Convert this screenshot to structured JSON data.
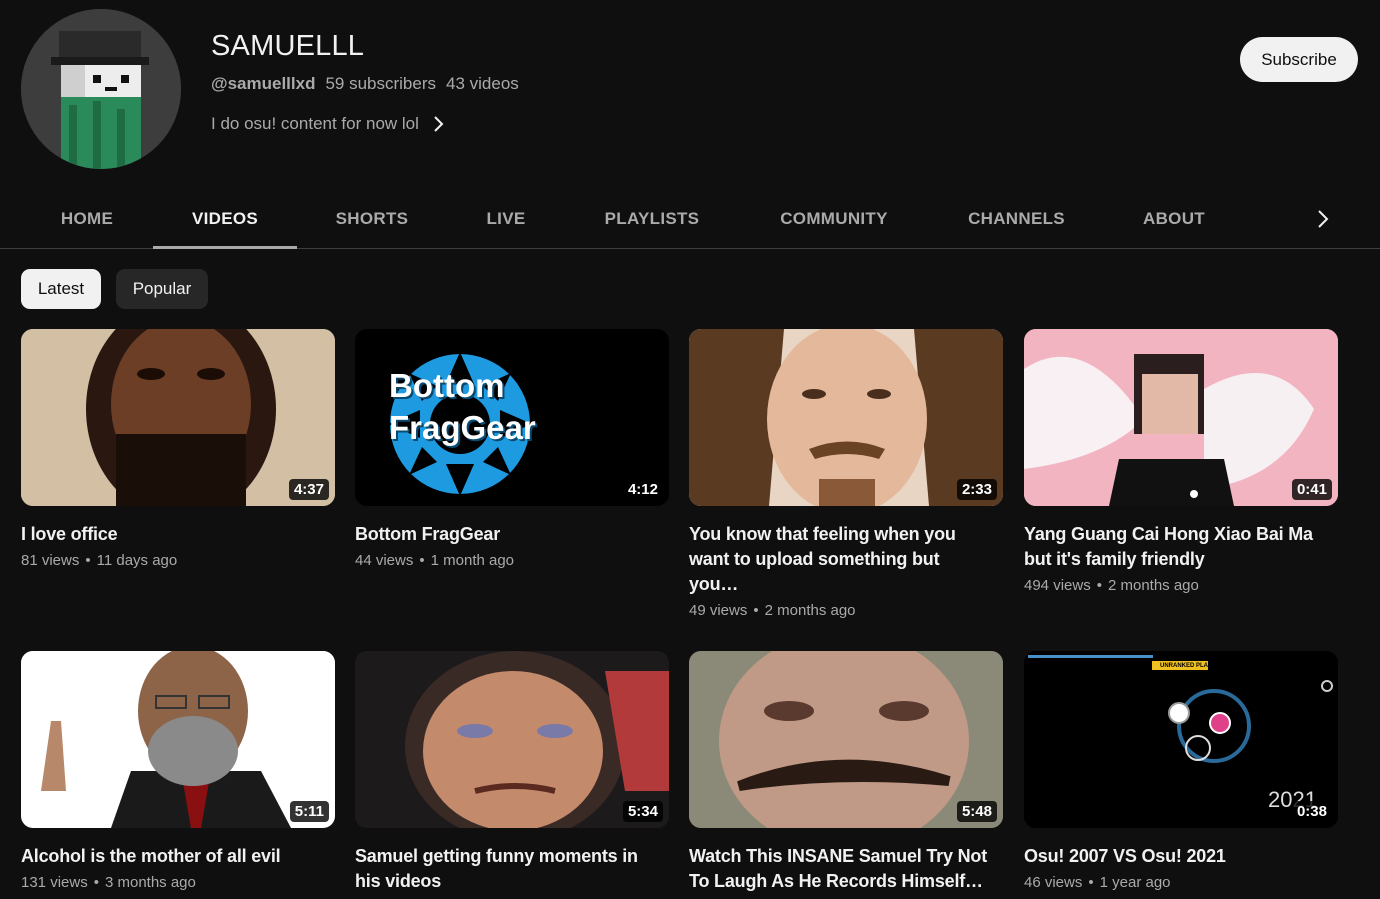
{
  "channel": {
    "name": "SAMUELLL",
    "handle": "@samuelllxd",
    "subscribers": "59 subscribers",
    "videos_count": "43 videos",
    "description": "I do osu! content for now lol",
    "subscribe_label": "Subscribe"
  },
  "tabs": [
    {
      "label": "HOME"
    },
    {
      "label": "VIDEOS"
    },
    {
      "label": "SHORTS"
    },
    {
      "label": "LIVE"
    },
    {
      "label": "PLAYLISTS"
    },
    {
      "label": "COMMUNITY"
    },
    {
      "label": "CHANNELS"
    },
    {
      "label": "ABOUT"
    }
  ],
  "active_tab": "VIDEOS",
  "chips": {
    "latest": "Latest",
    "popular": "Popular"
  },
  "videos": [
    {
      "title": "I love office",
      "views": "81 views",
      "age": "11 days ago",
      "duration": "4:37"
    },
    {
      "title": "Bottom FragGear",
      "views": "44 views",
      "age": "1 month ago",
      "duration": "4:12",
      "thumb_text_1": "Bottom",
      "thumb_text_2": "FragGear"
    },
    {
      "title": "You know that feeling when you want to upload something but you…",
      "views": "49 views",
      "age": "2 months ago",
      "duration": "2:33"
    },
    {
      "title": "Yang Guang Cai Hong Xiao Bai Ma but it's family friendly",
      "views": "494 views",
      "age": "2 months ago",
      "duration": "0:41"
    },
    {
      "title": "Alcohol is the mother of all evil",
      "views": "131 views",
      "age": "3 months ago",
      "duration": "5:11"
    },
    {
      "title": "Samuel getting funny moments in his videos",
      "views": "",
      "age": "",
      "duration": "5:34"
    },
    {
      "title": "Watch This INSANE Samuel Try Not To Laugh As He Records Himself…",
      "views": "",
      "age": "",
      "duration": "5:48"
    },
    {
      "title": "Osu! 2007 VS Osu! 2021",
      "views": "46 views",
      "age": "1 year ago",
      "duration": "0:38",
      "thumb_text": "2021",
      "thumb_badge": "UNRANKED PLAY"
    }
  ],
  "colors": {
    "background": "#0f0f0f",
    "text": "#f1f1f1",
    "muted": "#aaaaaa",
    "chip_bg": "#272727",
    "accent_blue": "#1d9ae0"
  }
}
